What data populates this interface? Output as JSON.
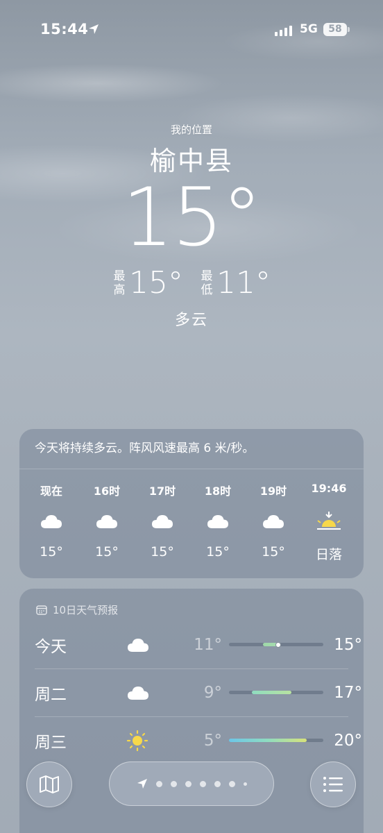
{
  "status": {
    "time": "15:44",
    "network": "5G",
    "battery": "58"
  },
  "hero": {
    "location_label": "我的位置",
    "city": "榆中县",
    "temp": "15°",
    "high_label": "最高",
    "high": "15°",
    "low_label": "最低",
    "low": "11°",
    "condition": "多云"
  },
  "hourly": {
    "summary": "今天将持续多云。阵风风速最高 6 米/秒。",
    "hours": [
      {
        "label": "现在",
        "icon": "cloud-icon",
        "temp": "15°"
      },
      {
        "label": "16时",
        "icon": "cloud-icon",
        "temp": "15°"
      },
      {
        "label": "17时",
        "icon": "cloud-icon",
        "temp": "15°"
      },
      {
        "label": "18时",
        "icon": "cloud-icon",
        "temp": "15°"
      },
      {
        "label": "19时",
        "icon": "cloud-icon",
        "temp": "15°"
      },
      {
        "label": "19:46",
        "icon": "sunset-icon",
        "temp": "日落"
      }
    ]
  },
  "daily": {
    "header": "10日天气预报",
    "days": [
      {
        "name": "今天",
        "icon": "cloud-icon",
        "low": "11°",
        "high": "15°",
        "bar_start": 0.36,
        "bar_end": 0.54,
        "current": 0.52,
        "color": "linear-gradient(90deg,#9fd8a8,#a5dcb0)"
      },
      {
        "name": "周二",
        "icon": "cloud-icon",
        "low": "9°",
        "high": "17°",
        "bar_start": 0.24,
        "bar_end": 0.66,
        "color": "linear-gradient(90deg,#8fdcc0,#b8e2a0)"
      },
      {
        "name": "周三",
        "icon": "sun-icon",
        "low": "5°",
        "high": "20°",
        "bar_start": 0.0,
        "bar_end": 0.82,
        "color": "linear-gradient(90deg,#6cc6e8,#8fdcc0,#d8e27a)"
      }
    ]
  },
  "toolbar": {
    "map_icon": "map-icon",
    "list_icon": "list-icon",
    "page_dots": 7,
    "current_page": 0
  }
}
